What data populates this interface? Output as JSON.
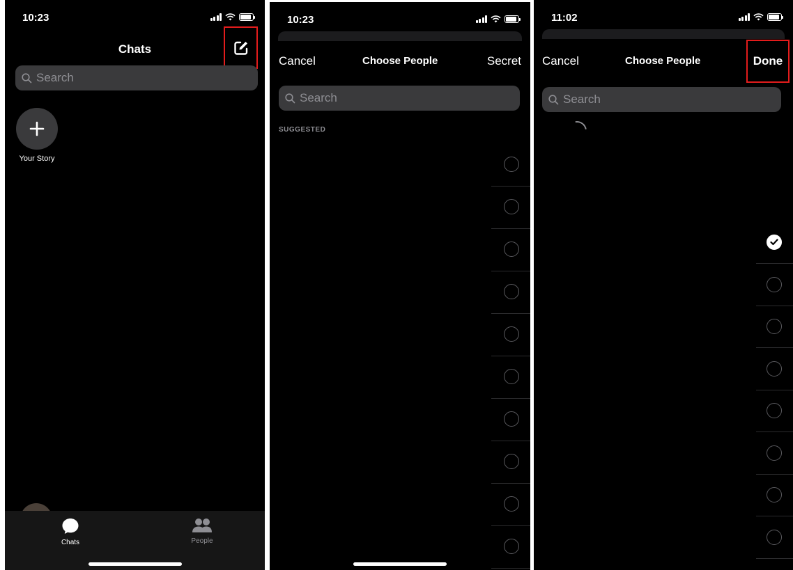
{
  "panel1": {
    "time": "10:23",
    "title": "Chats",
    "search_placeholder": "Search",
    "story_label": "Your Story",
    "tabs": [
      {
        "label": "Chats",
        "icon": "chat-bubble-icon"
      },
      {
        "label": "People",
        "icon": "people-icon"
      }
    ]
  },
  "panel2": {
    "time": "10:23",
    "cancel": "Cancel",
    "title": "Choose People",
    "right_action": "Secret",
    "search_placeholder": "Search",
    "section": "SUGGESTED",
    "rows": [
      {
        "selected": false
      },
      {
        "selected": false
      },
      {
        "selected": false
      },
      {
        "selected": false
      },
      {
        "selected": false
      },
      {
        "selected": false
      },
      {
        "selected": false
      },
      {
        "selected": false
      },
      {
        "selected": false
      },
      {
        "selected": false
      }
    ]
  },
  "panel3": {
    "time": "11:02",
    "cancel": "Cancel",
    "title": "Choose People",
    "right_action": "Done",
    "search_placeholder": "Search",
    "rows": [
      {
        "selected": true
      },
      {
        "selected": false
      },
      {
        "selected": false
      },
      {
        "selected": false
      },
      {
        "selected": false
      },
      {
        "selected": false
      },
      {
        "selected": false
      },
      {
        "selected": false
      }
    ]
  },
  "colors": {
    "background": "#000000",
    "highlight": "#e31c1c",
    "search_fill": "#3a3a3c",
    "placeholder": "#8e8e93"
  }
}
